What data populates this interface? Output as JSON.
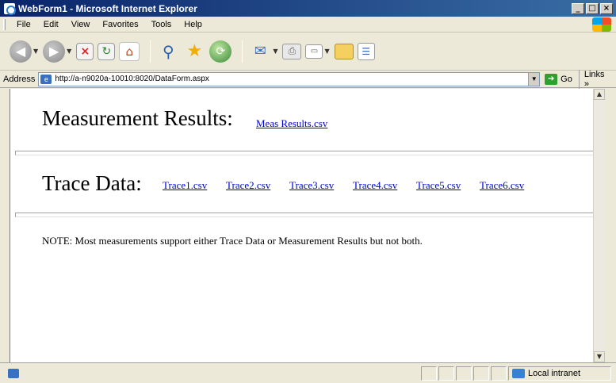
{
  "window": {
    "title": "WebForm1 - Microsoft Internet Explorer",
    "buttons": {
      "minimize": "_",
      "maximize": "□",
      "close": "×"
    }
  },
  "menu": [
    {
      "label": "File"
    },
    {
      "label": "Edit"
    },
    {
      "label": "View"
    },
    {
      "label": "Favorites"
    },
    {
      "label": "Tools"
    },
    {
      "label": "Help"
    }
  ],
  "toolbar": {
    "icons": [
      "back-icon",
      "forward-icon",
      "stop-icon",
      "refresh-icon",
      "home-icon",
      "search-icon",
      "favorites-star-icon",
      "history-icon",
      "mail-icon",
      "print-icon",
      "edit-icon",
      "folder-icon",
      "messenger-icon"
    ]
  },
  "address": {
    "label": "Address",
    "url": "http://a-n9020a-10010:8020/DataForm.aspx",
    "go_label": "Go",
    "links_label": "Links »"
  },
  "page": {
    "measurement_heading": "Measurement Results:",
    "measurement_link": "Meas Results.csv",
    "trace_heading": "Trace Data:",
    "trace_links": [
      "Trace1.csv",
      "Trace2.csv",
      "Trace3.csv",
      "Trace4.csv",
      "Trace5.csv",
      "Trace6.csv"
    ],
    "note": "NOTE: Most measurements support either Trace Data or Measurement Results but not both."
  },
  "status": {
    "zone": "Local intranet"
  },
  "colors": {
    "link": "#0000cc",
    "titlebar": "#0a246a"
  }
}
